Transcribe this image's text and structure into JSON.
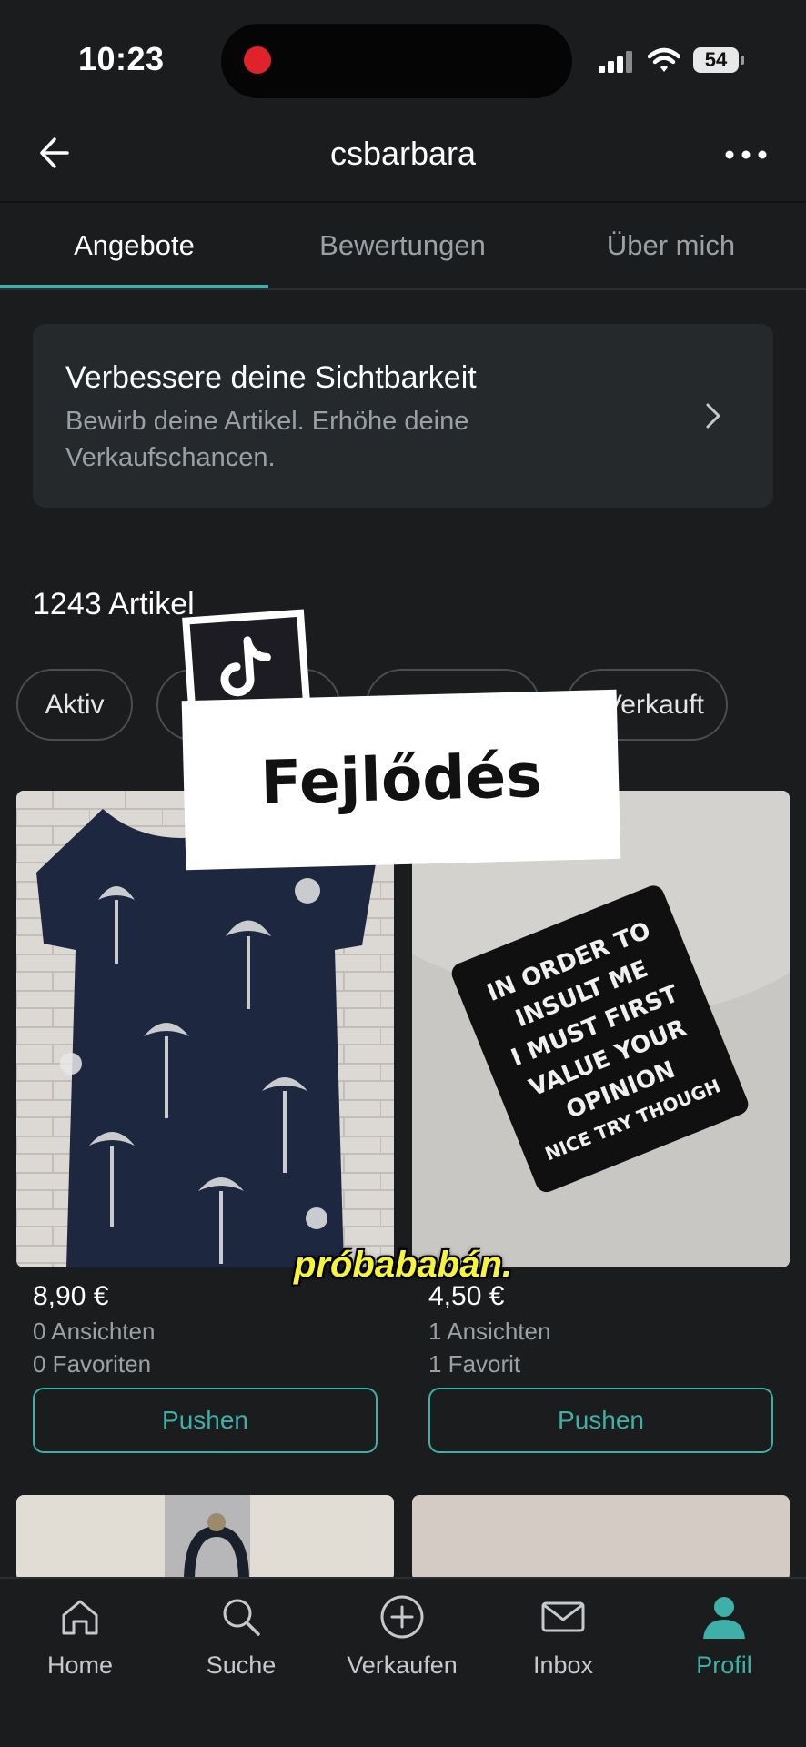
{
  "status_bar": {
    "time": "10:23",
    "battery": "54"
  },
  "header": {
    "username": "csbarbara",
    "back_icon": "arrow-left-icon",
    "more_icon": "ellipsis-icon"
  },
  "tabs": [
    {
      "label": "Angebote",
      "active": true
    },
    {
      "label": "Bewertungen",
      "active": false
    },
    {
      "label": "Über mich",
      "active": false
    }
  ],
  "promo": {
    "title": "Verbessere deine Sichtbarkeit",
    "text": "Bewirb deine Artikel. Erhöhe deine Verkaufschancen."
  },
  "items_count": "1243 Artikel",
  "filters": [
    "Aktiv",
    "",
    "",
    "Verkauft"
  ],
  "items": [
    {
      "price": "8,90 €",
      "views": "0 Ansichten",
      "favorites": "0 Favoriten",
      "push_label": "Pushen"
    },
    {
      "price": "4,50 €",
      "views": "1 Ansichten",
      "favorites": "1 Favorit",
      "push_label": "Pushen"
    }
  ],
  "product_pin_text": [
    "IN ORDER TO",
    "INSULT ME",
    "I MUST FIRST",
    "VALUE YOUR",
    "OPINION",
    "NICE TRY THOUGH"
  ],
  "overlay": {
    "banner": "Fejlődés",
    "caption": "próbababán."
  },
  "bottom_nav": [
    {
      "label": "Home",
      "icon": "home-icon",
      "active": false
    },
    {
      "label": "Suche",
      "icon": "search-icon",
      "active": false
    },
    {
      "label": "Verkaufen",
      "icon": "plus-circle-icon",
      "active": false
    },
    {
      "label": "Inbox",
      "icon": "mail-icon",
      "active": false
    },
    {
      "label": "Profil",
      "icon": "profile-icon",
      "active": true
    }
  ],
  "colors": {
    "background": "#1b1c1e",
    "accent": "#3fb0a7",
    "card": "#26292c",
    "muted_text": "#9ba0a5"
  }
}
